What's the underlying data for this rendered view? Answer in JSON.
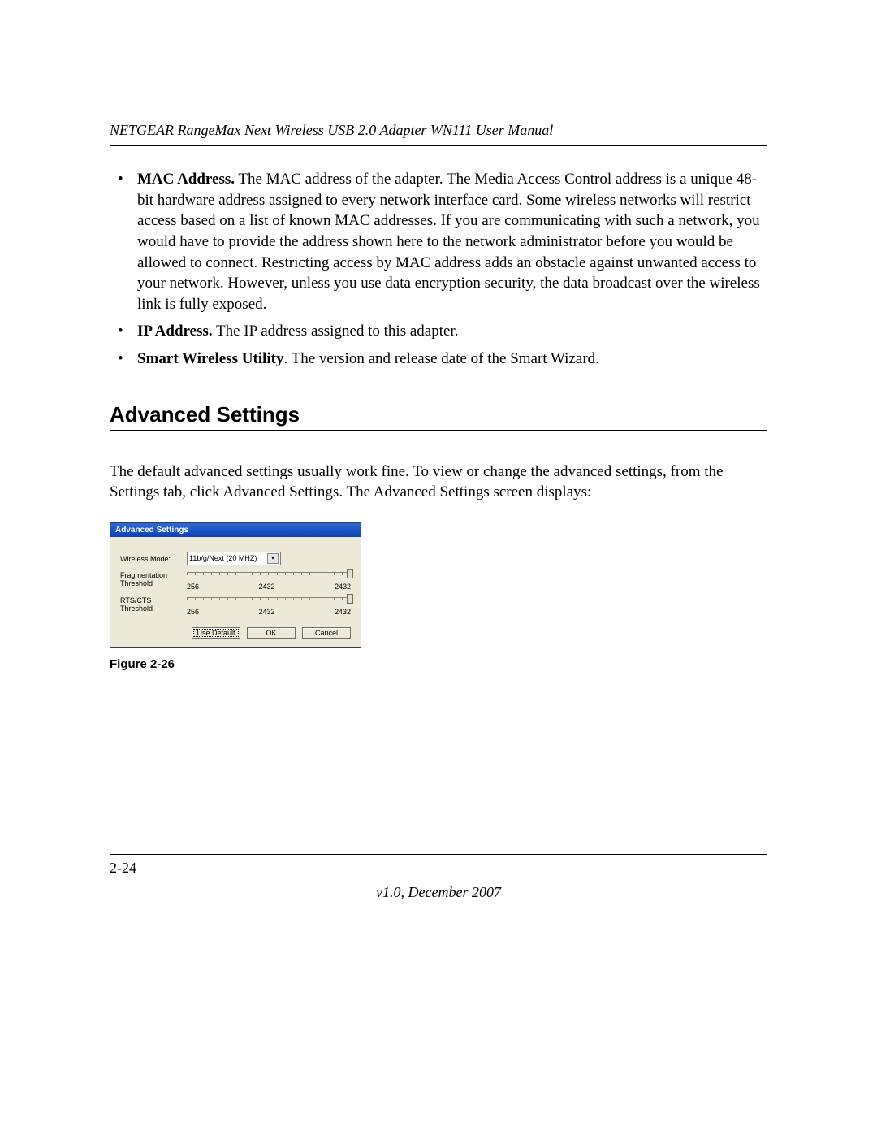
{
  "header": {
    "running_title": "NETGEAR RangeMax Next Wireless USB 2.0 Adapter WN111 User Manual"
  },
  "bullets": {
    "mac": {
      "label": "MAC Address.",
      "text": " The MAC address of the adapter. The Media Access Control address is a unique 48-bit hardware address assigned to every network interface card. Some wireless networks will restrict access based on a list of known MAC addresses. If you are communicating with such a network, you would have to provide the address shown here to the network administrator before you would be allowed to connect. Restricting access by MAC address adds an obstacle against unwanted access to your network. However, unless you use data encryption security, the data broadcast over the wireless link is fully exposed."
    },
    "ip": {
      "label": "IP Address.",
      "text": " The IP address assigned to this adapter."
    },
    "swu": {
      "label": "Smart Wireless Utility",
      "text": ". The version and release date of the Smart Wizard."
    }
  },
  "section": {
    "title": "Advanced Settings",
    "intro": "The default advanced settings usually work fine. To view or change the advanced settings, from the Settings tab, click Advanced Settings. The Advanced Settings screen displays:"
  },
  "dialog": {
    "title": "Advanced Settings",
    "wireless_mode_label": "Wireless Mode:",
    "wireless_mode_value": "11b/g/Next (20 MHZ)",
    "frag": {
      "label1": "Fragmentation",
      "label2": "Threshold",
      "min": "256",
      "mid": "2432",
      "max": "2432"
    },
    "rts": {
      "label1": "RTS/CTS",
      "label2": "Threshold",
      "min": "256",
      "mid": "2432",
      "max": "2432"
    },
    "buttons": {
      "use_default": "Use Default",
      "ok": "OK",
      "cancel": "Cancel"
    }
  },
  "figure_caption": "Figure 2-26",
  "footer": {
    "page": "2-24",
    "version": "v1.0, December 2007"
  }
}
